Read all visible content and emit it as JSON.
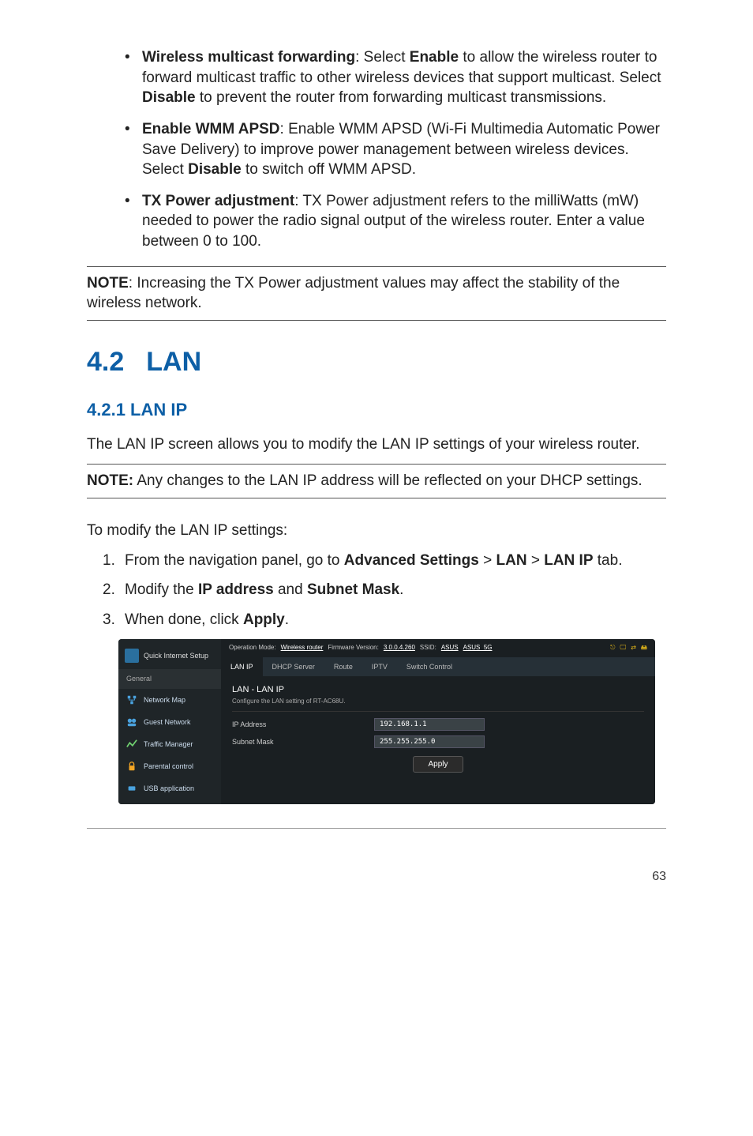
{
  "bullets": [
    {
      "title": "Wireless multicast forwarding",
      "text": ":  Select ",
      "strong1": "Enable",
      "text2": " to allow the wireless router to forward multicast traffic to other wireless devices that support multicast. Select ",
      "strong2": "Disable",
      "text3": " to prevent the router from forwarding multicast transmissions."
    },
    {
      "title": "Enable WMM APSD",
      "text": ":  Enable WMM APSD (Wi-Fi Multimedia Automatic Power Save Delivery) to improve power management between wireless devices. Select ",
      "strong1": "Disable",
      "text2": " to switch off WMM APSD.",
      "strong2": "",
      "text3": ""
    },
    {
      "title": "TX Power adjustment",
      "text": ":  TX Power adjustment refers to the milliWatts (mW) needed to power the radio signal output of the wireless router. Enter a value between 0 to 100.",
      "strong1": "",
      "text2": "",
      "strong2": "",
      "text3": ""
    }
  ],
  "note1_label": "NOTE",
  "note1_text": ":  Increasing the TX Power adjustment values may affect the stability of the wireless network.",
  "section_num": "4.2",
  "section_title": "LAN",
  "subsection": "4.2.1 LAN IP",
  "intro": "The LAN IP screen allows you to modify the LAN IP settings of your wireless router.",
  "note2_label": "NOTE:",
  "note2_text": "  Any changes to the LAN IP address will be reflected on your DHCP settings.",
  "steps_intro": "To modify the LAN IP settings:",
  "steps": [
    {
      "num": "1.",
      "pre": "From the navigation panel, go to ",
      "b1": "Advanced Settings",
      "mid1": " > ",
      "b2": "LAN",
      "mid2": " > ",
      "b3": "LAN IP",
      "post": " tab."
    },
    {
      "num": "2.",
      "pre": "Modify the ",
      "b1": "IP address",
      "mid1": " and ",
      "b2": "Subnet Mask",
      "mid2": ".",
      "b3": "",
      "post": ""
    },
    {
      "num": "3.",
      "pre": "When done, click ",
      "b1": "Apply",
      "mid1": ".",
      "b2": "",
      "mid2": "",
      "b3": "",
      "post": ""
    }
  ],
  "ui": {
    "quick_setup": "Quick Internet Setup",
    "general": "General",
    "side_items": [
      "Network Map",
      "Guest Network",
      "Traffic Manager",
      "Parental control",
      "USB application"
    ],
    "op_mode_label": "Operation Mode:",
    "op_mode": "Wireless router",
    "fw_label": "Firmware Version:",
    "fw": "3.0.0.4.260",
    "ssid_label": "SSID:",
    "ssid1": "ASUS",
    "ssid2": "ASUS_5G",
    "tabs": [
      "LAN IP",
      "DHCP Server",
      "Route",
      "IPTV",
      "Switch Control"
    ],
    "panel_title": "LAN - LAN IP",
    "panel_sub": "Configure the LAN setting of RT-AC68U.",
    "ip_label": "IP Address",
    "ip_value": "192.168.1.1",
    "mask_label": "Subnet Mask",
    "mask_value": "255.255.255.0",
    "apply": "Apply"
  },
  "page_num": "63"
}
